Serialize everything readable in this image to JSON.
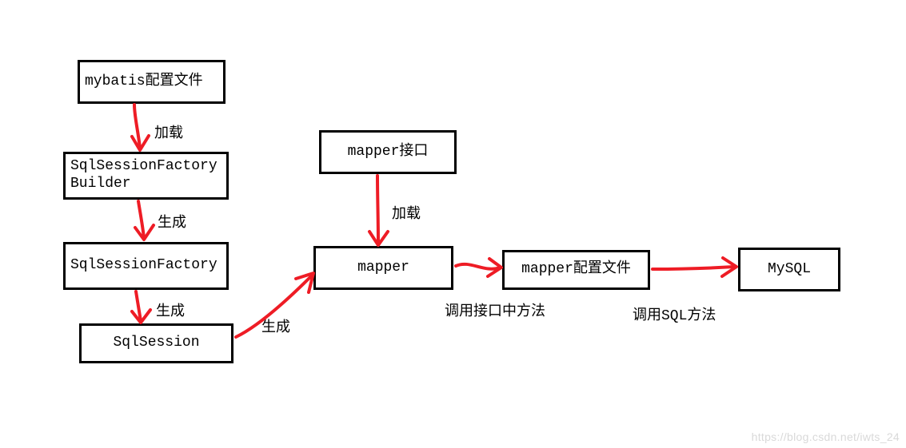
{
  "boxes": {
    "mybatis_config": "mybatis配置文件",
    "sql_session_factory_builder": "SqlSessionFactoryBuilder",
    "sql_session_factory": "SqlSessionFactory",
    "sql_session": "SqlSession",
    "mapper_interface": "mapper接口",
    "mapper": "mapper",
    "mapper_config": "mapper配置文件",
    "mysql": "MySQL"
  },
  "labels": {
    "load1": "加载",
    "gen1": "生成",
    "gen2": "生成",
    "gen3": "生成",
    "load2": "加载",
    "call_interface": "调用接口中方法",
    "call_sql": "调用SQL方法"
  },
  "watermark": "https://blog.csdn.net/iwts_24",
  "colors": {
    "arrow": "#ee1c25"
  }
}
